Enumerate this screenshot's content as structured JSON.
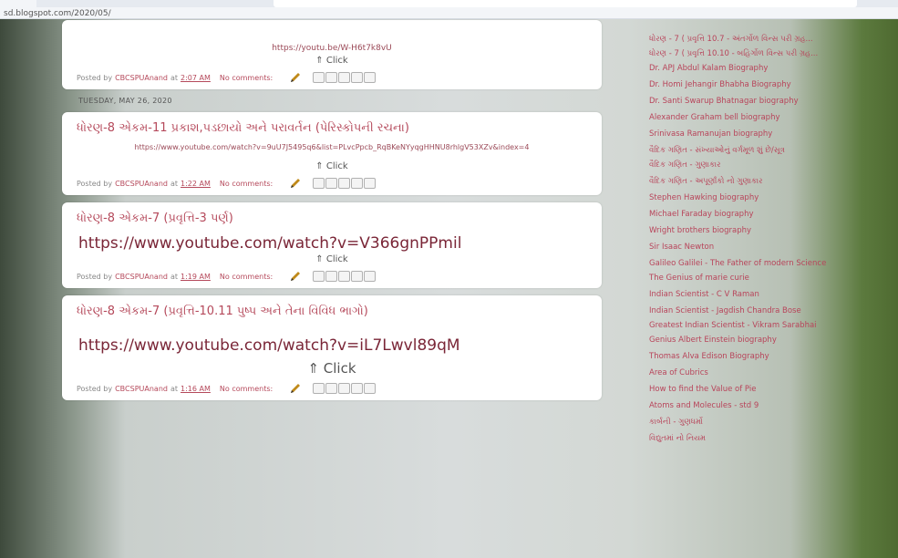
{
  "browser": {
    "url": "sd.blogspot.com/2020/05/"
  },
  "posts": [
    {
      "title": "",
      "link": "https://youtu.be/W-H6t7k8vU",
      "link_style": "small",
      "click": "⇑ Click",
      "footer": {
        "posted_by": "Posted by",
        "author": "CBCSPUAnand",
        "at": "at",
        "time": "2:07 AM",
        "comments": "No comments:"
      }
    },
    {
      "title": "ધોરણ-8 એકમ-11 પ્રકાશ,પડછાયો અને પરાવર્તન (પેરિસ્કોપની રચના)",
      "link": "https://www.youtube.com/watch?v=9uU7J5495q6&list=PLvcPpcb_RqBKeNYyqgHHNU8rhlgV53XZv&index=4",
      "link_style": "small",
      "click": "⇑ Click",
      "footer": {
        "posted_by": "Posted by",
        "author": "CBCSPUAnand",
        "at": "at",
        "time": "1:22 AM",
        "comments": "No comments:"
      }
    },
    {
      "title": "ધોરણ-8 એકમ-7 (પ્રવૃત્તિ-3 પર્ણ)",
      "link": "https://www.youtube.com/watch?v=V366gnPPmil",
      "link_style": "big",
      "click": "⇑ Click",
      "footer": {
        "posted_by": "Posted by",
        "author": "CBCSPUAnand",
        "at": "at",
        "time": "1:19 AM",
        "comments": "No comments:"
      }
    },
    {
      "title": "ધોરણ-8 એકમ-7 (પ્રવૃત્તિ-10.11 પુષ્પ અને તેના વિવિધ ભાગો)",
      "link": "https://www.youtube.com/watch?v=iL7Lwvl89qM",
      "link_style": "big",
      "click": "⇑ Click",
      "footer": {
        "posted_by": "Posted by",
        "author": "CBCSPUAnand",
        "at": "at",
        "time": "1:16 AM",
        "comments": "No comments:"
      }
    }
  ],
  "date_header": "TUESDAY, MAY 26, 2020",
  "sidebar": {
    "links": [
      "ધોરણ - 7 ( પ્રવૃત્તિ 10.7 - અંતર્ગોળ વિન્સ પરી ગ્રહ...",
      "ધોરણ - 7 ( પ્રવૃત્તિ 10.10 - બહિર્ગોળ વિન્સ પરી ગ્રહ...",
      "Dr. APJ Abdul Kalam Biography",
      "Dr. Homi Jehangir Bhabha Biography",
      "Dr. Santi Swarup Bhatnagar biography",
      "Alexander Graham bell biography",
      "Srinivasa Ramanujan biography",
      "વૈદિક ગણિત - સંખ્યાઓનું વર્ગમૂળ શું છે/સૂત્ર",
      "વૈદિક ગણિત - ગુણાકાર",
      "વૈદિક ગણિત - અપૂર્ણાંકો નો ગુણાકાર",
      "Stephen Hawking biography",
      "Michael Faraday biography",
      "Wright brothers biography",
      "Sir Isaac Newton",
      "Galileo Galilei - The Father of modern Science",
      "The Genius of marie curie",
      "Indian Scientist - C V Raman",
      "Indian Scientist - Jagdish Chandra Bose",
      "Greatest Indian Scientist - Vikram Sarabhai",
      "Genius Albert Einstein biography",
      "Thomas Alva Edison Biography",
      "Area of Cubrics",
      "How to find the Value of Pie",
      "Atoms and Molecules - std 9",
      "કાર્બની - ગુણધર્મો",
      "વિદ્યુતમાં નો નિયમ"
    ]
  }
}
